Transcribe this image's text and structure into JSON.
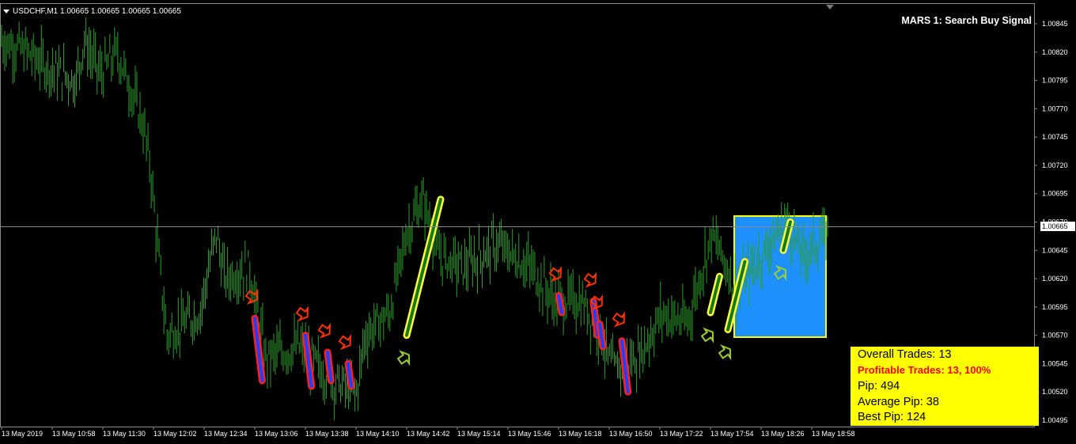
{
  "header": {
    "symbol_info": "USDCHF,M1  1.00665 1.00665 1.00665 1.00665",
    "indicator_title": "MARS 1: Search Buy Signal"
  },
  "current_price": "1.00665",
  "stats": {
    "overall_trades": "Overall Trades: 13",
    "profitable_trades": "Profitable Trades: 13, 100%",
    "pip": "Pip: 494",
    "average_pip": "Average Pip: 38",
    "best_pip": "Best Pip: 124"
  },
  "colors": {
    "background": "#000000",
    "candles": "#2e9e2e",
    "sell_signal": "#ff3300",
    "buy_signal": "#9acd32",
    "highlight_box": "#1e90ff",
    "stats_box": "#ffff00",
    "price_line": "#808080"
  },
  "chart_data": {
    "type": "line",
    "title": "USDCHF,M1",
    "y_ticks": [
      "1.00845",
      "1.00820",
      "1.00795",
      "1.00770",
      "1.00745",
      "1.00720",
      "1.00695",
      "1.00670",
      "1.00645",
      "1.00620",
      "1.00595",
      "1.00570",
      "1.00545",
      "1.00520",
      "1.00495"
    ],
    "x_ticks": [
      "13 May 2019",
      "13 May 10:58",
      "13 May 11:30",
      "13 May 12:02",
      "13 May 12:34",
      "13 May 13:06",
      "13 May 13:38",
      "13 May 14:10",
      "13 May 14:42",
      "13 May 15:14",
      "13 May 15:46",
      "13 May 16:18",
      "13 May 16:50",
      "13 May 17:22",
      "13 May 17:54",
      "13 May 18:26",
      "13 May 18:58"
    ],
    "ylim": [
      1.00485,
      1.0086
    ],
    "current_price": 1.00665,
    "price_path": [
      [
        0,
        1.0083
      ],
      [
        0.03,
        1.0082
      ],
      [
        0.06,
        1.00805
      ],
      [
        0.09,
        1.00795
      ],
      [
        0.1,
        1.0083
      ],
      [
        0.12,
        1.008
      ],
      [
        0.14,
        1.0082
      ],
      [
        0.16,
        1.0078
      ],
      [
        0.17,
        1.0076
      ],
      [
        0.18,
        1.0072
      ],
      [
        0.19,
        1.0064
      ],
      [
        0.2,
        1.0057
      ],
      [
        0.22,
        1.0058
      ],
      [
        0.24,
        1.0059
      ],
      [
        0.26,
        1.0066
      ],
      [
        0.27,
        1.0062
      ],
      [
        0.3,
        1.0063
      ],
      [
        0.32,
        1.0055
      ],
      [
        0.36,
        1.0056
      ],
      [
        0.4,
        1.0053
      ],
      [
        0.43,
        1.0052
      ],
      [
        0.44,
        1.0057
      ],
      [
        0.47,
        1.0059
      ],
      [
        0.49,
        1.0066
      ],
      [
        0.51,
        1.0069
      ],
      [
        0.53,
        1.0064
      ],
      [
        0.56,
        1.0063
      ],
      [
        0.6,
        1.0065
      ],
      [
        0.64,
        1.0063
      ],
      [
        0.67,
        1.006
      ],
      [
        0.7,
        1.006
      ],
      [
        0.72,
        1.0058
      ],
      [
        0.74,
        1.0054
      ],
      [
        0.77,
        1.0055
      ],
      [
        0.8,
        1.0059
      ],
      [
        0.83,
        1.0058
      ],
      [
        0.86,
        1.0066
      ],
      [
        0.89,
        1.0061
      ],
      [
        0.92,
        1.0064
      ],
      [
        0.95,
        1.0067
      ],
      [
        0.97,
        1.0064
      ],
      [
        1.0,
        1.0066
      ]
    ],
    "sell_signals": [
      {
        "x_label": "13 May 13:06",
        "from": 1.00585,
        "to": 1.0053
      },
      {
        "x_label": "13 May 13:38",
        "from": 1.0057,
        "to": 1.00525
      },
      {
        "x_label": "13 May 13:52",
        "from": 1.00555,
        "to": 1.0053
      },
      {
        "x_label": "13 May 14:05",
        "from": 1.00545,
        "to": 1.00525
      },
      {
        "x_label": "13 May 16:18",
        "from": 1.00605,
        "to": 1.0059
      },
      {
        "x_label": "13 May 16:40",
        "from": 1.006,
        "to": 1.0057
      },
      {
        "x_label": "13 May 16:44",
        "from": 1.0058,
        "to": 1.0056
      },
      {
        "x_label": "13 May 16:58",
        "from": 1.00565,
        "to": 1.0052
      }
    ],
    "buy_signals": [
      {
        "x_label": "13 May 14:42",
        "from": 1.0057,
        "to": 1.0069
      },
      {
        "x_label": "13 May 17:54",
        "from": 1.0059,
        "to": 1.00622
      },
      {
        "x_label": "13 May 18:05",
        "from": 1.00575,
        "to": 1.00635
      },
      {
        "x_label": "13 May 18:40",
        "from": 1.00645,
        "to": 1.0067
      }
    ]
  }
}
